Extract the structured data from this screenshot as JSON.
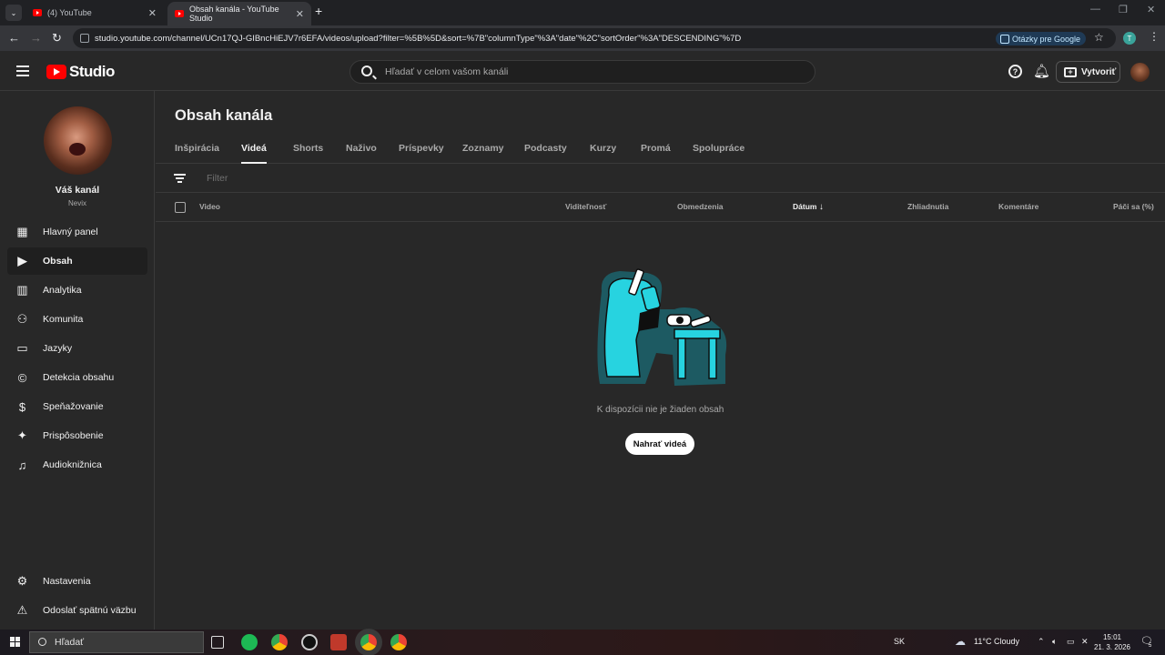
{
  "browser": {
    "tabs": [
      {
        "title": "(4) YouTube"
      },
      {
        "title": "Obsah kanála - YouTube Studio"
      }
    ],
    "url": "studio.youtube.com/channel/UCn17QJ-GIBncHiEJV7r6EFA/videos/upload?filter=%5B%5D&sort=%7B\"columnType\"%3A\"date\"%2C\"sortOrder\"%3A\"DESCENDING\"%7D",
    "google_questions": "Otázky pre Google",
    "profile_initial": "T"
  },
  "header": {
    "logo_text": "Studio",
    "search_placeholder": "Hľadať v celom vašom kanáli",
    "create_label": "Vytvoriť"
  },
  "channel": {
    "name": "Váš kanál",
    "handle": "Nevix"
  },
  "sidebar": {
    "items": [
      {
        "label": "Hlavný panel",
        "icon": "dashboard-icon"
      },
      {
        "label": "Obsah",
        "icon": "content-icon"
      },
      {
        "label": "Analytika",
        "icon": "analytics-icon"
      },
      {
        "label": "Komunita",
        "icon": "community-icon"
      },
      {
        "label": "Jazyky",
        "icon": "subtitles-icon"
      },
      {
        "label": "Detekcia obsahu",
        "icon": "copyright-icon"
      },
      {
        "label": "Speňažovanie",
        "icon": "monetization-icon"
      },
      {
        "label": "Prispôsobenie",
        "icon": "customization-icon"
      },
      {
        "label": "Audioknižnica",
        "icon": "audio-library-icon"
      }
    ],
    "bottom": [
      {
        "label": "Nastavenia",
        "icon": "gear-icon"
      },
      {
        "label": "Odoslať spätnú väzbu",
        "icon": "feedback-icon"
      }
    ]
  },
  "main": {
    "title": "Obsah kanála",
    "tabs": [
      "Inšpirácia",
      "Videá",
      "Shorts",
      "Naživo",
      "Príspevky",
      "Zoznamy",
      "Podcasty",
      "Kurzy",
      "Promá",
      "Spolupráce"
    ],
    "active_tab": "Videá",
    "filter_placeholder": "Filter",
    "columns": [
      "Video",
      "Viditeľnosť",
      "Obmedzenia",
      "Dátum",
      "Zhliadnutia",
      "Komentáre",
      "Páči sa (%)"
    ],
    "sorted_column": "Dátum",
    "empty_text": "K dispozícii nie je žiaden obsah",
    "upload_button": "Nahrať videá"
  },
  "taskbar": {
    "search_placeholder": "Hľadať",
    "language": "SK",
    "weather": "11°C  Cloudy",
    "time": "15:01",
    "date": "21. 3. 2026",
    "notifications": "5"
  },
  "colors": {
    "background": "#282828",
    "accent_red": "#ff0000",
    "illustration_teal": "#27d3e0"
  }
}
